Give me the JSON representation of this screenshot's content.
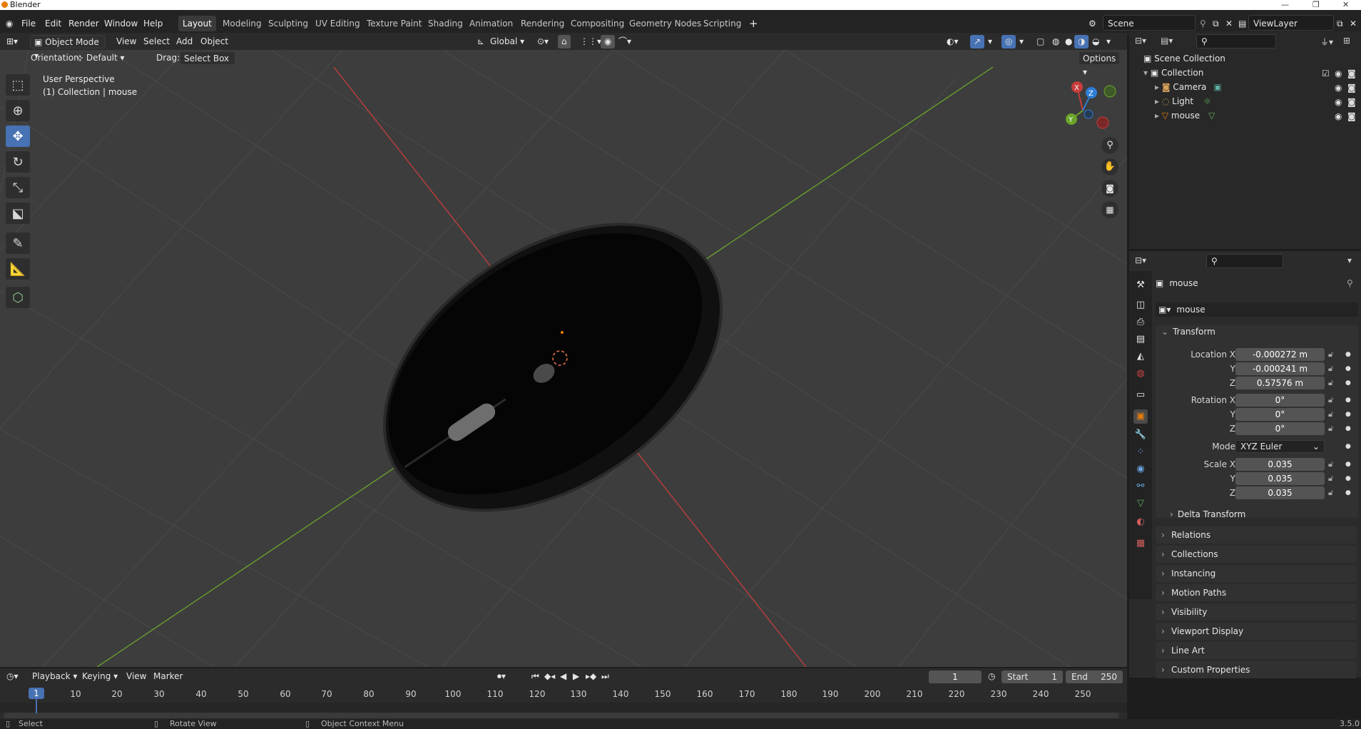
{
  "window": {
    "title": "Blender",
    "version": "3.5.0"
  },
  "menu": {
    "file": "File",
    "edit": "Edit",
    "render": "Render",
    "window": "Window",
    "help": "Help"
  },
  "workspaces": [
    "Layout",
    "Modeling",
    "Sculpting",
    "UV Editing",
    "Texture Paint",
    "Shading",
    "Animation",
    "Rendering",
    "Compositing",
    "Geometry Nodes",
    "Scripting"
  ],
  "active_workspace": "Layout",
  "scene": {
    "name": "Scene",
    "view_layer": "ViewLayer"
  },
  "viewport_header": {
    "mode": "Object Mode",
    "view": "View",
    "select": "Select",
    "add": "Add",
    "object": "Object",
    "transform_orientation": "Global",
    "options": "Options"
  },
  "tool_settings": {
    "orientation_label": "Orientation:",
    "orientation_value": "Default",
    "drag_label": "Drag:",
    "drag_value": "Select Box"
  },
  "viewport": {
    "perspective": "User Perspective",
    "collection_info": "(1) Collection | mouse",
    "gizmo": {
      "x": "X",
      "y": "Y",
      "z": "Z"
    }
  },
  "outliner": {
    "root": "Scene Collection",
    "collection": "Collection",
    "items": [
      "Camera",
      "Light",
      "mouse"
    ]
  },
  "properties": {
    "object_name": "mouse",
    "data_name": "mouse",
    "transform_title": "Transform",
    "location_label": "Location X",
    "location": [
      "-0.000272 m",
      "-0.000241 m",
      "0.57576 m"
    ],
    "rotation_label": "Rotation X",
    "rotation": [
      "0°",
      "0°",
      "0°"
    ],
    "mode_label": "Mode",
    "mode_value": "XYZ Euler",
    "scale_label": "Scale X",
    "scale": [
      "0.035",
      "0.035",
      "0.035"
    ],
    "axis_y": "Y",
    "axis_z": "Z",
    "delta_transform": "Delta Transform",
    "panels": [
      "Relations",
      "Collections",
      "Instancing",
      "Motion Paths",
      "Visibility",
      "Viewport Display",
      "Line Art",
      "Custom Properties"
    ]
  },
  "timeline": {
    "playback": "Playback",
    "keying": "Keying",
    "view": "View",
    "marker": "Marker",
    "current_frame": "1",
    "start_label": "Start",
    "start": "1",
    "end_label": "End",
    "end": "250",
    "ruler_marks": [
      "1",
      "10",
      "20",
      "30",
      "40",
      "50",
      "60",
      "70",
      "80",
      "90",
      "100",
      "110",
      "120",
      "130",
      "140",
      "150",
      "160",
      "170",
      "180",
      "190",
      "200",
      "210",
      "220",
      "230",
      "240",
      "250"
    ]
  },
  "status": {
    "select": "Select",
    "rotate": "Rotate View",
    "context": "Object Context Menu"
  },
  "colors": {
    "accent": "#4772b3",
    "x_axis": "#c83c3c",
    "y_axis": "#6aa52a",
    "z_axis": "#2e7dd6",
    "orange": "#e87d0d"
  }
}
